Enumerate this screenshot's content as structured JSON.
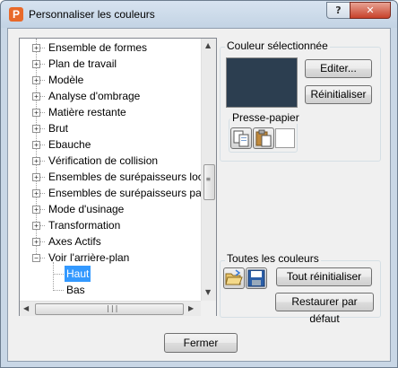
{
  "window": {
    "app_icon_letter": "P",
    "title": "Personnaliser les couleurs",
    "help_label": "?",
    "close_label": "✕"
  },
  "tree": {
    "items": [
      {
        "label": "Ensemble de formes",
        "expander": "+"
      },
      {
        "label": "Plan de travail",
        "expander": "+"
      },
      {
        "label": "Modèle",
        "expander": "+"
      },
      {
        "label": "Analyse d'ombrage",
        "expander": "+"
      },
      {
        "label": "Matière restante",
        "expander": "+"
      },
      {
        "label": "Brut",
        "expander": "+"
      },
      {
        "label": "Ebauche",
        "expander": "+"
      },
      {
        "label": "Vérification de collision",
        "expander": "+"
      },
      {
        "label": "Ensembles de surépaisseurs loca",
        "expander": "+"
      },
      {
        "label": "Ensembles de surépaisseurs par c",
        "expander": "+"
      },
      {
        "label": "Mode d'usinage",
        "expander": "+"
      },
      {
        "label": "Transformation",
        "expander": "+"
      },
      {
        "label": "Axes Actifs",
        "expander": "+"
      },
      {
        "label": "Voir l'arrière-plan",
        "expander": "−"
      }
    ],
    "children": [
      {
        "label": "Haut",
        "selected": true
      },
      {
        "label": "Bas",
        "selected": false
      }
    ]
  },
  "selected_color": {
    "group_label": "Couleur sélectionnée",
    "swatch_color": "#2c3e50",
    "edit_button": "Editer...",
    "reset_button": "Réinitialiser",
    "clipboard_label": "Presse-papier",
    "copy_icon": "copy-icon",
    "paste_icon": "paste-icon"
  },
  "all_colors": {
    "group_label": "Toutes les couleurs",
    "reset_all_button": "Tout réinitialiser",
    "restore_default_button": "Restaurer par défaut",
    "open_icon": "folder-open-icon",
    "save_icon": "save-icon"
  },
  "footer": {
    "close_button": "Fermer"
  }
}
